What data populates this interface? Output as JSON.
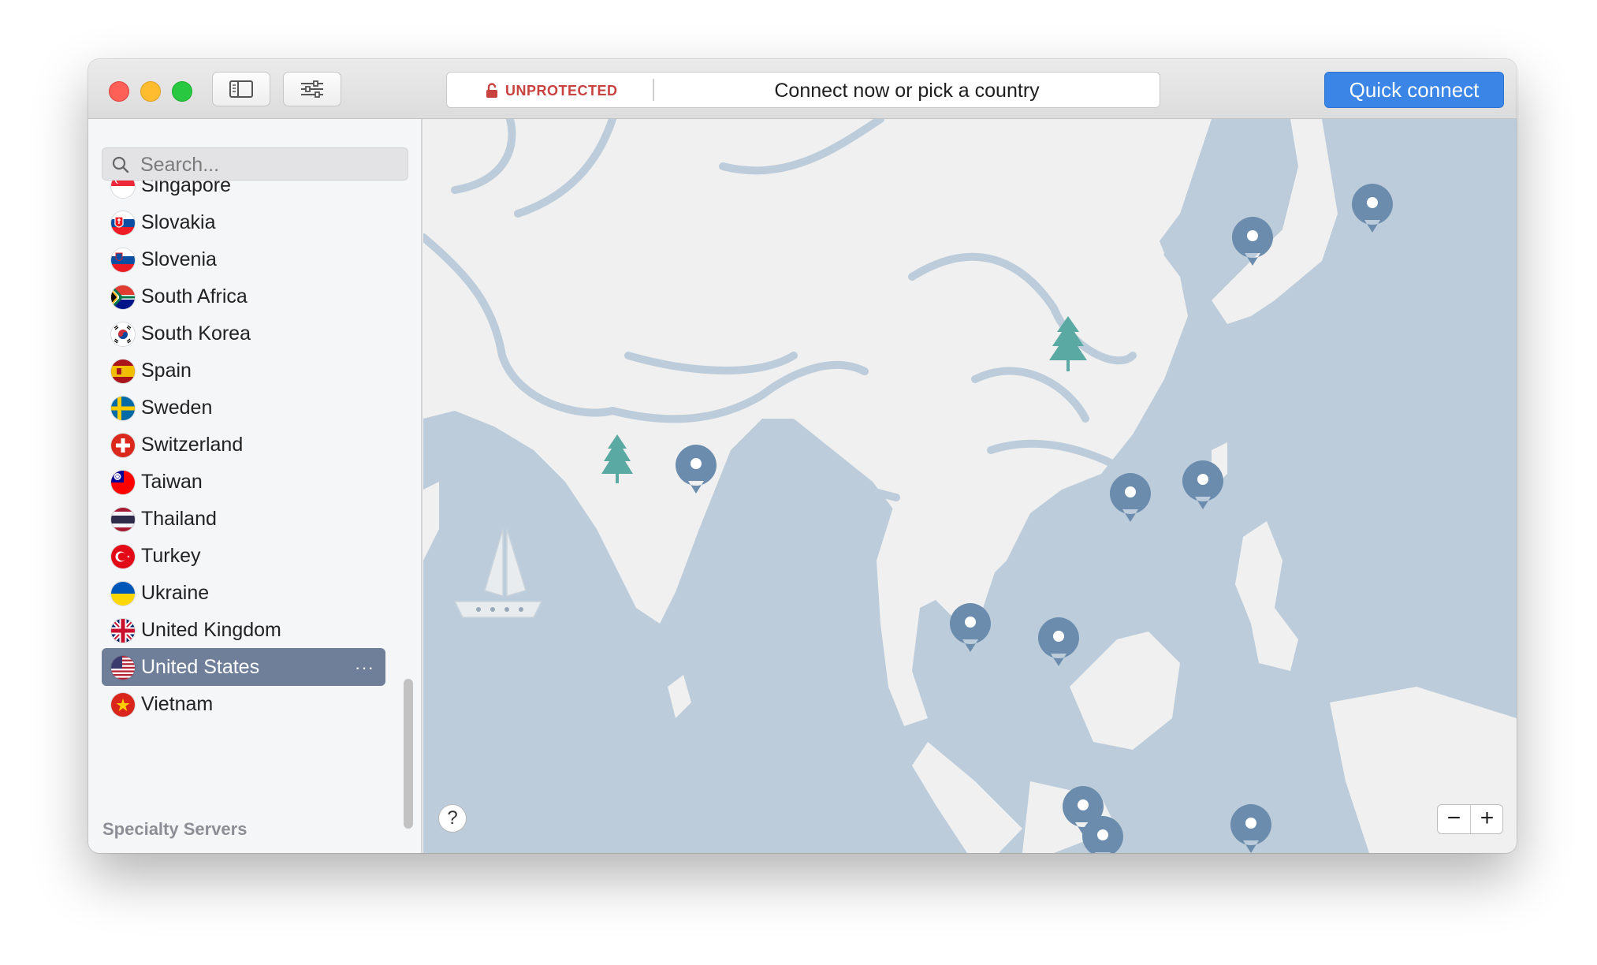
{
  "window": {
    "sidebar_toggle_icon": "sidebar-icon",
    "settings_icon": "sliders-icon"
  },
  "status": {
    "label": "UNPROTECTED",
    "message": "Connect now or pick a country",
    "lock_icon": "unlocked-padlock-icon",
    "label_color": "#c8423f"
  },
  "quick_connect": {
    "label": "Quick connect",
    "color": "#3a85e6"
  },
  "search": {
    "placeholder": "Search..."
  },
  "countries": [
    {
      "name": "Singapore",
      "flag": "singapore-flag-icon"
    },
    {
      "name": "Slovakia",
      "flag": "slovakia-flag-icon"
    },
    {
      "name": "Slovenia",
      "flag": "slovenia-flag-icon"
    },
    {
      "name": "South Africa",
      "flag": "south-africa-flag-icon"
    },
    {
      "name": "South Korea",
      "flag": "south-korea-flag-icon"
    },
    {
      "name": "Spain",
      "flag": "spain-flag-icon"
    },
    {
      "name": "Sweden",
      "flag": "sweden-flag-icon"
    },
    {
      "name": "Switzerland",
      "flag": "switzerland-flag-icon"
    },
    {
      "name": "Taiwan",
      "flag": "taiwan-flag-icon"
    },
    {
      "name": "Thailand",
      "flag": "thailand-flag-icon"
    },
    {
      "name": "Turkey",
      "flag": "turkey-flag-icon"
    },
    {
      "name": "Ukraine",
      "flag": "ukraine-flag-icon"
    },
    {
      "name": "United Kingdom",
      "flag": "uk-flag-icon"
    },
    {
      "name": "United States",
      "flag": "us-flag-icon",
      "selected": true
    },
    {
      "name": "Vietnam",
      "flag": "vietnam-flag-icon"
    }
  ],
  "selected_more_icon": "···",
  "specialty_header": "Specialty Servers",
  "map": {
    "land_color": "#f0f0f0",
    "water_color": "#bcccdb",
    "pin_color": "#6b8cac"
  },
  "help": {
    "label": "?"
  },
  "zoom": {
    "out_label": "−",
    "in_label": "+"
  }
}
